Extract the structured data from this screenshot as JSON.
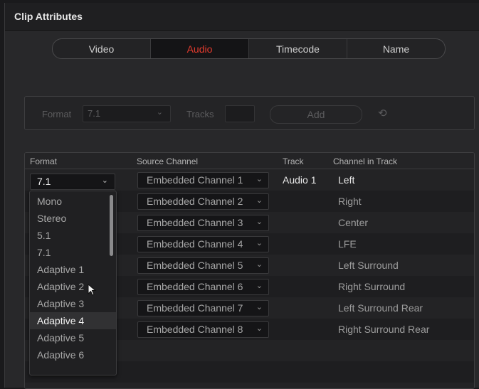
{
  "window": {
    "title": "Clip Attributes"
  },
  "tabs": [
    {
      "label": "Video",
      "active": false
    },
    {
      "label": "Audio",
      "active": true
    },
    {
      "label": "Timecode",
      "active": false
    },
    {
      "label": "Name",
      "active": false
    }
  ],
  "format_toolbar": {
    "format_label": "Format",
    "format_value": "7.1",
    "tracks_label": "Tracks",
    "tracks_value": "",
    "add_label": "Add",
    "reset_icon": "reset-icon"
  },
  "table": {
    "headers": [
      "Format",
      "Source Channel",
      "Track",
      "Channel in Track"
    ],
    "format_value": "7.1",
    "track_value": "Audio 1",
    "rows": [
      {
        "source": "Embedded Channel 1",
        "channel": "Left"
      },
      {
        "source": "Embedded Channel 2",
        "channel": "Right"
      },
      {
        "source": "Embedded Channel 3",
        "channel": "Center"
      },
      {
        "source": "Embedded Channel 4",
        "channel": "LFE"
      },
      {
        "source": "Embedded Channel 5",
        "channel": "Left Surround"
      },
      {
        "source": "Embedded Channel 6",
        "channel": "Right Surround"
      },
      {
        "source": "Embedded Channel 7",
        "channel": "Left Surround Rear"
      },
      {
        "source": "Embedded Channel 8",
        "channel": "Right Surround Rear"
      }
    ]
  },
  "format_dropdown": {
    "options": [
      "Mono",
      "Stereo",
      "5.1",
      "7.1",
      "Adaptive 1",
      "Adaptive 2",
      "Adaptive 3",
      "Adaptive 4",
      "Adaptive 5",
      "Adaptive 6"
    ],
    "highlighted": "Adaptive 4"
  },
  "colors": {
    "active_tab_text": "#e23b2e",
    "background": "#28282a"
  }
}
